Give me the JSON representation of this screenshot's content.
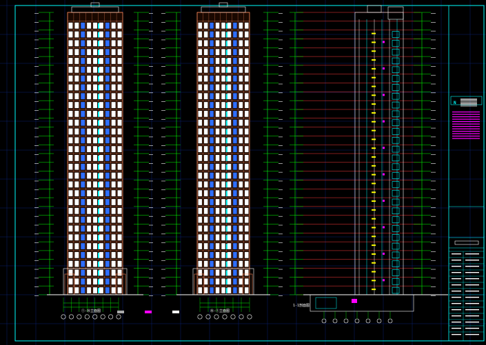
{
  "drawing": {
    "background": "#000000",
    "frame_color": "#00ffff",
    "grid_color": "#0a2a8a",
    "floor_line_color": "#ff3b3b",
    "level_tick_color": "#00ff00",
    "facade_color": "#ff8a5c",
    "window_color": "#ffffff",
    "accent_cyan": "#00ffff",
    "accent_magenta": "#ff00ff",
    "accent_yellow": "#ffff00"
  },
  "elevations": [
    {
      "id": "elev-1",
      "title": "①-⑩立面图"
    },
    {
      "id": "elev-2",
      "title": "⑩-①立面图"
    },
    {
      "id": "section",
      "title": "1-1剖面图"
    }
  ],
  "floors": 32,
  "title_block": {
    "logo_text": "N",
    "rows": 14
  }
}
